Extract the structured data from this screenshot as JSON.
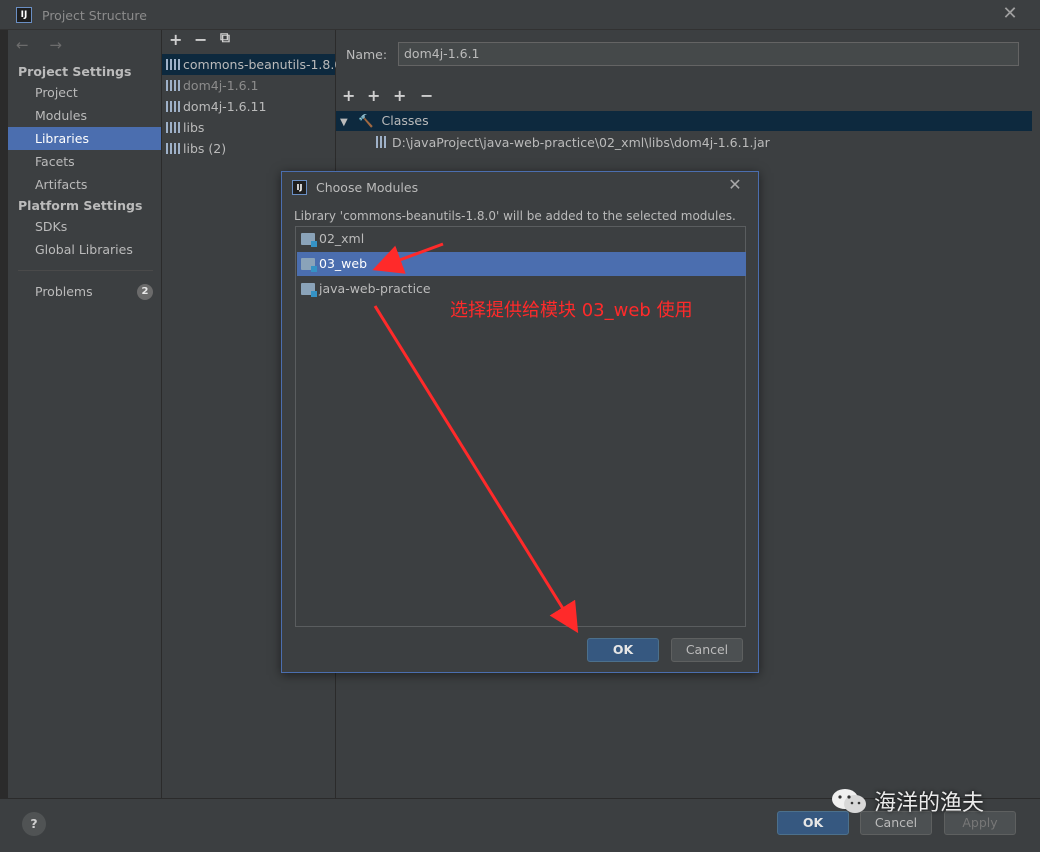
{
  "window": {
    "title": "Project Structure",
    "app_icon": "IJ"
  },
  "nav": {
    "back_forward": "← →",
    "project_settings_header": "Project Settings",
    "project_settings_items": [
      "Project",
      "Modules",
      "Libraries",
      "Facets",
      "Artifacts"
    ],
    "platform_settings_header": "Platform Settings",
    "platform_settings_items": [
      "SDKs",
      "Global Libraries"
    ],
    "problems_label": "Problems",
    "problems_count": "2",
    "selected": "Libraries"
  },
  "libraries": {
    "toolbar": [
      "+",
      "−",
      "⧉"
    ],
    "items": [
      "commons-beanutils-1.8.0",
      "dom4j-1.6.1",
      "dom4j-1.6.11",
      "libs",
      "libs (2)"
    ],
    "selected": "commons-beanutils-1.8.0"
  },
  "detail": {
    "name_label": "Name:",
    "name_value": "dom4j-1.6.1",
    "toolbar": [
      "+",
      "+",
      "+",
      "−"
    ],
    "classes_label": "Classes",
    "jar_path": "D:\\javaProject\\java-web-practice\\02_xml\\libs\\dom4j-1.6.1.jar"
  },
  "dialog": {
    "title": "Choose Modules",
    "message": "Library 'commons-beanutils-1.8.0' will be added to the selected modules.",
    "modules": [
      "02_xml",
      "03_web",
      "java-web-practice"
    ],
    "selected": "03_web",
    "ok_label": "OK",
    "cancel_label": "Cancel"
  },
  "annotation": "选择提供给模块 03_web 使用",
  "bottom": {
    "help_label": "?",
    "ok_label": "OK",
    "cancel_label": "Cancel",
    "apply_label": "Apply"
  },
  "watermark": "海洋的渔夫",
  "colors": {
    "selection": "#4b6eaf",
    "panel": "#3c3f41",
    "annotation": "#ff2a2a",
    "primary_button": "#365880"
  }
}
